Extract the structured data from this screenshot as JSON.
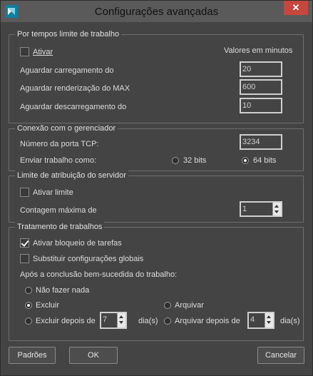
{
  "window": {
    "title": "Configurações avançadas",
    "close_glyph": "✕",
    "app_icon": "3ds-max-icon"
  },
  "timeouts": {
    "title": "Por tempos limite de trabalho",
    "enable_label": "Ativar",
    "enable_checked": false,
    "units_label": "Valores em minutos",
    "load_label": "Aguardar carregamento do",
    "load_value": "20",
    "render_label": "Aguardar renderização do MAX",
    "render_value": "600",
    "unload_label": "Aguardar descarregamento do",
    "unload_value": "10"
  },
  "manager": {
    "title": "Conexão com o gerenciador",
    "tcp_label": "Número da porta TCP:",
    "tcp_value": "3234",
    "send_label": "Enviar trabalho como:",
    "bits32_label": "32 bits",
    "bits64_label": "64 bits",
    "selected": "64 bits"
  },
  "server_limit": {
    "title": "Limite de atribuição do servidor",
    "enable_label": "Ativar limite",
    "enable_checked": false,
    "max_label": "Contagem máxima de",
    "max_value": "1"
  },
  "job_handling": {
    "title": "Tratamento de trabalhos",
    "lock_label": "Ativar bloqueio de tarefas",
    "lock_checked": true,
    "override_label": "Substituir configurações globais",
    "override_checked": false,
    "after_label": "Após a conclusão bem-sucedida do trabalho:",
    "do_nothing_label": "Não fazer nada",
    "delete_label": "Excluir",
    "archive_label": "Arquivar",
    "delete_after_label": "Excluir depois de",
    "delete_after_value": "7",
    "archive_after_label": "Arquivar depois de",
    "archive_after_value": "4",
    "days_label": "dia(s)",
    "selected": "Excluir"
  },
  "buttons": {
    "defaults": "Padrões",
    "ok": "OK",
    "cancel": "Cancelar"
  }
}
